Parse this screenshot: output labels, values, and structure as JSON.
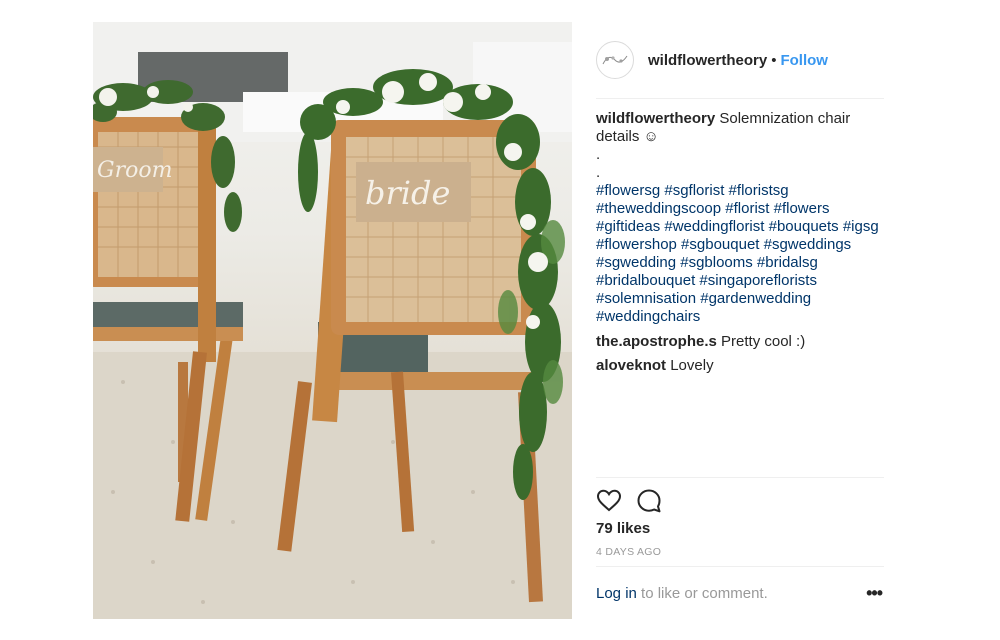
{
  "post": {
    "username": "wildflowertheory",
    "separator": "•",
    "follow_label": "Follow",
    "caption": {
      "username": "wildflowertheory",
      "text": "Solemnization chair details ☺",
      "periods": [
        ".",
        "."
      ],
      "hashtag_lines": [
        "#flowersg #sgflorist #floristsg",
        "#theweddingscoop #florist #flowers",
        "#giftideas #weddingflorist #bouquets #igsg",
        "#flowershop #sgbouquet #sgweddings",
        "#sgwedding #sgblooms #bridalsg",
        "#bridalbouquet #singaporeflorists",
        "#solemnisation #gardenwedding",
        "#weddingchairs"
      ]
    },
    "comments": [
      {
        "username": "the.apostrophe.s",
        "text": "Pretty cool :)"
      },
      {
        "username": "aloveknot",
        "text": "Lovely"
      }
    ],
    "likes": "79 likes",
    "time_ago": "4 DAYS AGO",
    "login_link": "Log in",
    "login_text": "to like or comment.",
    "more_label": "•••"
  },
  "photo": {
    "sign_left": "Groom",
    "sign_right": "bride"
  },
  "icons": {
    "like": "heart-icon",
    "comment": "speech-bubble-icon",
    "avatar": "floral-logo"
  },
  "colors": {
    "link": "#003569",
    "follow": "#3897f0",
    "muted": "#999999",
    "text": "#262626"
  }
}
